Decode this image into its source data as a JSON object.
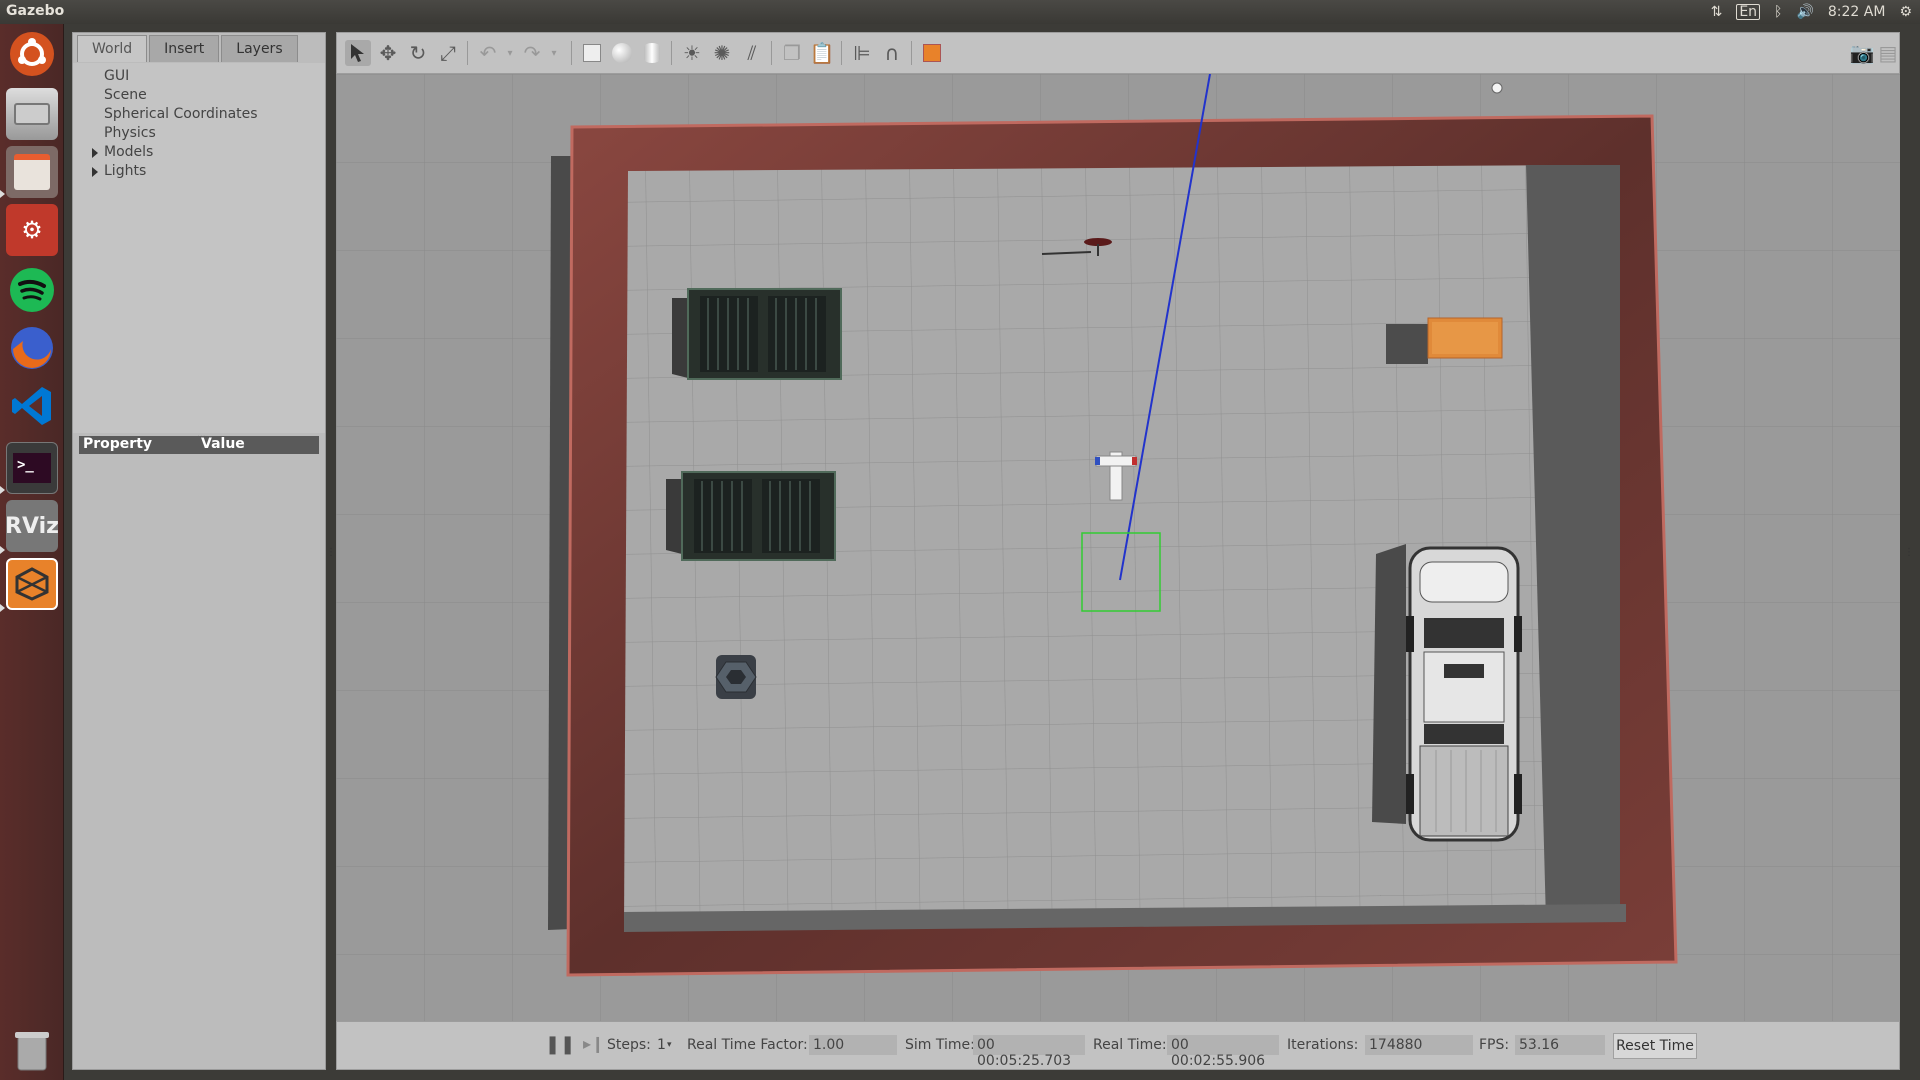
{
  "app": {
    "title": "Gazebo"
  },
  "system_tray": {
    "keyboard": "En",
    "time": "8:22 AM"
  },
  "launcher": {
    "items": [
      {
        "name": "ubuntu-dash",
        "icon": "ubuntu-logo-icon",
        "color": "#c0392b"
      },
      {
        "name": "files-drive",
        "icon": "hard-drive-icon",
        "color": "#9a9a9a"
      },
      {
        "name": "file-manager",
        "icon": "file-cabinet-icon",
        "color": "#e85d30"
      },
      {
        "name": "system-settings",
        "icon": "gear-wrench-icon",
        "color": "#c0392b"
      },
      {
        "name": "spotify",
        "icon": "spotify-icon",
        "color": "#1db954"
      },
      {
        "name": "firefox",
        "icon": "firefox-icon",
        "color": "#e86a1a"
      },
      {
        "name": "vscode",
        "icon": "vscode-icon",
        "color": "#0078d4"
      },
      {
        "name": "terminal",
        "icon": "terminal-icon",
        "color": "#2d2d2d"
      },
      {
        "name": "rviz",
        "icon": "rviz-icon",
        "color": "#777777"
      },
      {
        "name": "gazebo",
        "icon": "gazebo-icon",
        "color": "#e8822a"
      },
      {
        "name": "trash",
        "icon": "trash-icon",
        "color": "#888888"
      }
    ]
  },
  "left_panel": {
    "tabs": [
      {
        "label": "World",
        "active": true
      },
      {
        "label": "Insert",
        "active": false
      },
      {
        "label": "Layers",
        "active": false
      }
    ],
    "tree": [
      {
        "label": "GUI",
        "expandable": false
      },
      {
        "label": "Scene",
        "expandable": false
      },
      {
        "label": "Spherical Coordinates",
        "expandable": false
      },
      {
        "label": "Physics",
        "expandable": false
      },
      {
        "label": "Models",
        "expandable": true
      },
      {
        "label": "Lights",
        "expandable": true
      }
    ],
    "property_header": {
      "property": "Property",
      "value": "Value"
    }
  },
  "toolbar": {
    "tools": [
      "select-mode-icon",
      "translate-mode-icon",
      "rotate-mode-icon",
      "scale-mode-icon",
      "undo-icon",
      "undo-history-icon",
      "redo-icon",
      "redo-history-icon",
      "box-shape-icon",
      "sphere-shape-icon",
      "cylinder-shape-icon",
      "point-light-icon",
      "spot-light-icon",
      "directional-light-icon",
      "copy-icon",
      "paste-icon",
      "align-icon",
      "snap-icon",
      "change-view-icon",
      "screenshot-icon",
      "record-log-icon"
    ]
  },
  "bottom_bar": {
    "steps_label": "Steps:",
    "steps_value": "1",
    "rtf_label": "Real Time Factor:",
    "rtf_value": "1.00",
    "sim_time_label": "Sim Time:",
    "sim_time_value": "00 00:05:25.703",
    "real_time_label": "Real Time:",
    "real_time_value": "00 00:02:55.906",
    "iterations_label": "Iterations:",
    "iterations_value": "174880",
    "fps_label": "FPS:",
    "fps_value": "53.16",
    "reset_label": "Reset Time"
  },
  "scene": {
    "colors": {
      "floor": "#a9a9a9",
      "wall": "#7a3e38",
      "wall_edge": "#b5625a",
      "shelf": "#2e3a33",
      "orange_box": "#e08a3a",
      "truck": "#d8d8d8",
      "laser_line": "#2233cc",
      "goal_box": "#33cc33"
    }
  }
}
